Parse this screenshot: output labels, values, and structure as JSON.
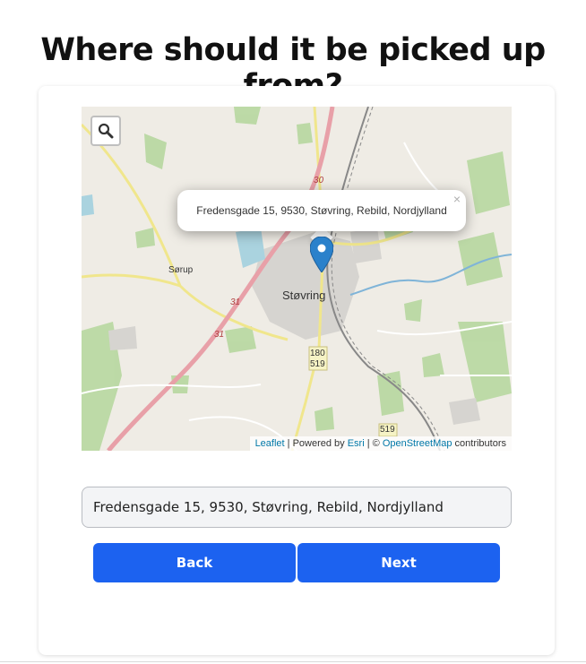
{
  "page": {
    "title": "Where should it be picked up from?"
  },
  "map": {
    "zoom_icon": "magnifier-icon",
    "popup_text": "Fredensgade 15, 9530, Støvring, Rebild, Nordjylland",
    "popup_close": "×",
    "marker_icon": "map-pin-icon",
    "labels": {
      "town": "Støvring",
      "village": "Sørup",
      "road_30": "30",
      "road_31a": "31",
      "road_31b": "31",
      "road_180": "180",
      "road_519a": "519",
      "road_519b": "519"
    },
    "attribution": {
      "leaflet": "Leaflet",
      "sep1": " | Powered by ",
      "esri": "Esri",
      "sep2": " | © ",
      "osm": "OpenStreetMap",
      "suffix": " contributors"
    }
  },
  "form": {
    "address_value": "Fredensgade 15, 9530, Støvring, Rebild, Nordjylland"
  },
  "buttons": {
    "back_label": "Back",
    "next_label": "Next"
  },
  "colors": {
    "primary": "#1c62f0",
    "marker": "#2a81cb"
  }
}
